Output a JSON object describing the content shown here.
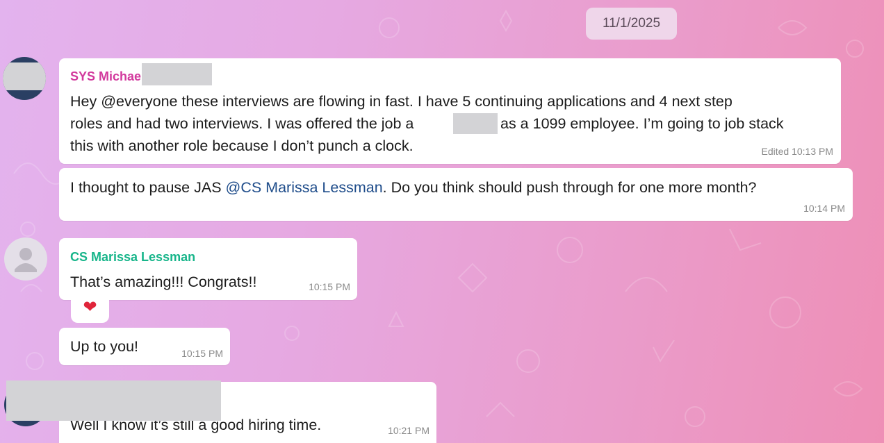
{
  "date_separator": "11/1/2025",
  "messages": [
    {
      "sender": "SYS Michae",
      "lines": [
        "Hey @everyone these interviews are flowing in fast. I have 5 continuing applications and 4 next step",
        "roles and had two interviews. I was offered the job a",
        "as a 1099 employee. I’m going to job stack",
        "this with another role because I don’t punch a clock."
      ],
      "time": "Edited 10:13 PM"
    },
    {
      "text_before": "I thought to pause JAS ",
      "mention": "@CS Marissa Lessman",
      "text_after": ". Do you think should push through for one more month?",
      "time": "10:14 PM"
    },
    {
      "sender": "CS Marissa Lessman",
      "text": "That’s amazing!!! Congrats!!",
      "time": "10:15 PM",
      "reaction": "❤"
    },
    {
      "text": "Up to you!",
      "time": "10:15 PM"
    },
    {
      "text": "Well I know it’s still a good hiring time.",
      "time": "10:21 PM"
    }
  ],
  "colors": {
    "sender_sys": "#d2399d",
    "sender_cs": "#17b58a",
    "mention": "#1e4c8a"
  }
}
